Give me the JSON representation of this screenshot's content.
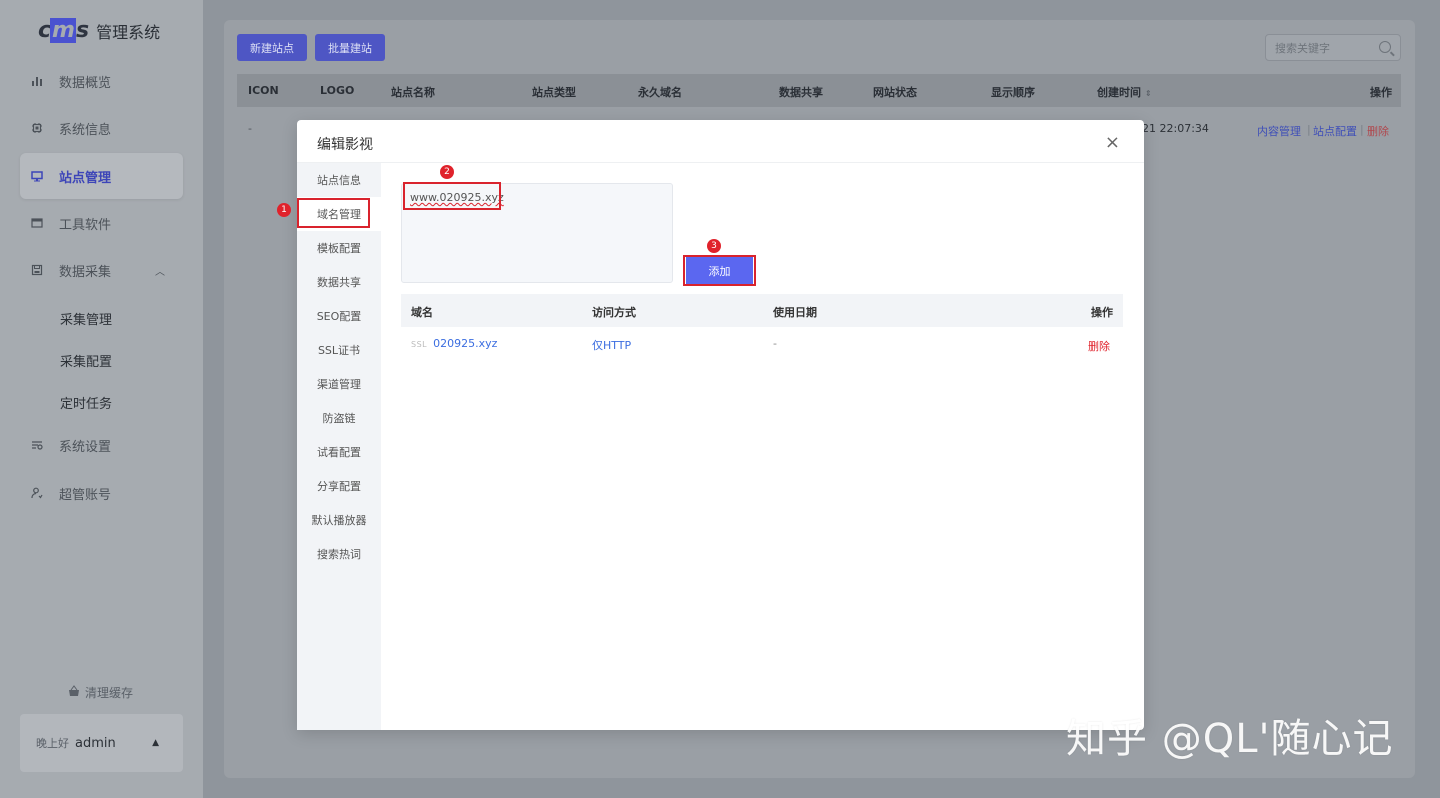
{
  "app": {
    "logo_text": "cms",
    "title": "管理系统"
  },
  "sidebar": {
    "items": [
      {
        "label": "数据概览",
        "icon": "bar-chart-icon"
      },
      {
        "label": "系统信息",
        "icon": "chip-icon"
      },
      {
        "label": "站点管理",
        "icon": "monitor-icon",
        "active": true
      },
      {
        "label": "工具软件",
        "icon": "window-icon"
      },
      {
        "label": "数据采集",
        "icon": "save-icon",
        "expanded": true
      },
      {
        "label": "采集管理"
      },
      {
        "label": "采集配置"
      },
      {
        "label": "定时任务"
      },
      {
        "label": "系统设置",
        "icon": "sliders-icon"
      },
      {
        "label": "超管账号",
        "icon": "user-icon"
      }
    ],
    "clear_cache": "清理缓存",
    "greeting": "晚上好",
    "username": "admin"
  },
  "toolbar": {
    "new_site": "新建站点",
    "batch_create": "批量建站",
    "search_placeholder": "搜索关键字"
  },
  "sites_table": {
    "headers": [
      "ICON",
      "LOGO",
      "站点名称",
      "站点类型",
      "永久域名",
      "数据共享",
      "网站状态",
      "显示顺序",
      "创建时间",
      "操作"
    ],
    "row": {
      "icon": "-",
      "created_partial": "21 22:07:34",
      "actions": [
        "内容管理",
        "站点配置",
        "删除"
      ]
    }
  },
  "modal": {
    "title": "编辑影视",
    "close": "×",
    "tabs": [
      "站点信息",
      "域名管理",
      "模板配置",
      "数据共享",
      "SEO配置",
      "SSL证书",
      "渠道管理",
      "防盗链",
      "试看配置",
      "分享配置",
      "默认播放器",
      "搜索热词"
    ],
    "active_tab": "域名管理",
    "domain_input_value": "www.020925.xyz",
    "add_button": "添加",
    "annotations": [
      "1",
      "2",
      "3"
    ],
    "domain_table": {
      "headers": [
        "域名",
        "访问方式",
        "使用日期",
        "操作"
      ],
      "rows": [
        {
          "ssl": "SSL",
          "domain": "020925.xyz",
          "access": "仅HTTP",
          "date": "-",
          "action": "删除"
        }
      ]
    }
  },
  "watermark": "知乎 @QL'随心记",
  "colors": {
    "accent": "#4e56c4",
    "add_button": "#5b67f0",
    "link": "#3c6ee0",
    "danger": "#e0222b"
  }
}
